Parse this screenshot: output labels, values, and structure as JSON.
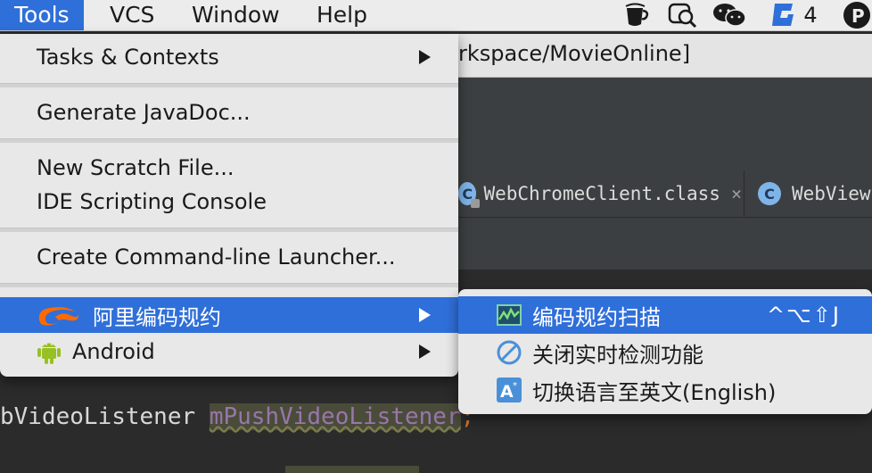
{
  "menubar": {
    "items": [
      "Tools",
      "VCS",
      "Window",
      "Help"
    ],
    "tray_badge_count": "4",
    "tray_icons": [
      "coffee-cup-icon",
      "search-chat-icon",
      "wechat-icon",
      "g-app-icon",
      "p-app-icon"
    ]
  },
  "window": {
    "title_fragment": "rkspace/MovieOnline]"
  },
  "tabs": [
    {
      "label": "WebChromeClient.class",
      "close": "×",
      "icon_letter": "C"
    },
    {
      "label": "WebView",
      "icon_letter": "C"
    }
  ],
  "editor": {
    "code_prefix": "bVideoListener ",
    "field": "mPushVideoListener",
    "semicolon": ";"
  },
  "tools_menu": {
    "items": [
      {
        "label": "Tasks & Contexts",
        "submenu": true
      },
      {
        "label": "Generate JavaDoc..."
      },
      {
        "label": "New Scratch File..."
      },
      {
        "label": "IDE Scripting Console"
      },
      {
        "label": "Create Command-line Launcher..."
      },
      {
        "label": "阿里编码规约",
        "submenu": true,
        "highlighted": true,
        "icon": "alibaba-logo-icon"
      },
      {
        "label": "Android",
        "submenu": true,
        "icon": "android-icon"
      }
    ]
  },
  "ali_submenu": {
    "items": [
      {
        "label": "编码规约扫描",
        "shortcut": "^⌥⇧J",
        "highlighted": true,
        "icon": "scan-chart-icon"
      },
      {
        "label": "关闭实时检测功能",
        "icon": "disable-circle-icon"
      },
      {
        "label": "切换语言至英文(English)",
        "icon": "translate-icon"
      }
    ]
  },
  "colors": {
    "highlight": "#2f6fd9",
    "menu_bg": "#e8e8e8",
    "ide_dark": "#3c3f41",
    "editor_bg": "#2b2b2b"
  }
}
